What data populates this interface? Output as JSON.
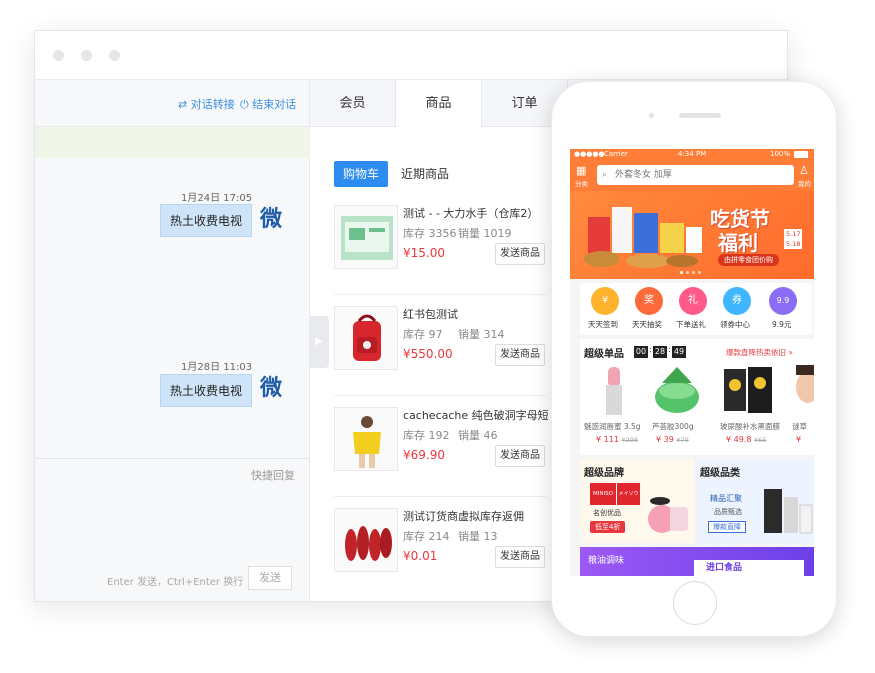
{
  "chat": {
    "transfer": "对话转接",
    "end": "结束对话",
    "messages": [
      {
        "time": "1月24日 17:05",
        "text": "热土收费电视"
      },
      {
        "time": "1月28日 11:03",
        "text": "热土收费电视"
      }
    ],
    "avatar_char": "微",
    "quick_reply": "快捷回复",
    "hint": "Enter 发送，Ctrl+Enter 换行",
    "send": "发送"
  },
  "tabs": [
    "会员",
    "商品",
    "订单"
  ],
  "active_tab": "商品",
  "subtabs": {
    "cart": "购物车",
    "recent": "近期商品"
  },
  "products": [
    {
      "name": "测试 - - 大力水手（仓库2）",
      "stock": "库存 3356",
      "sales": "销量 1019",
      "price": "¥15.00",
      "send": "发送商品"
    },
    {
      "name": "红书包测试",
      "stock": "库存 97",
      "sales": "销量 314",
      "price": "¥550.00",
      "send": "发送商品"
    },
    {
      "name": "cachecache 纯色破洞字母短袖...",
      "stock": "库存 192",
      "sales": "销量 46",
      "price": "¥69.90",
      "send": "发送商品"
    },
    {
      "name": "测试订货商虚拟库存返佣",
      "stock": "库存 214",
      "sales": "销量 13",
      "price": "¥0.01",
      "send": "发送商品"
    }
  ],
  "phone": {
    "status": {
      "carrier": "Carrier",
      "time": "4:34 PM",
      "battery": "100%"
    },
    "category": "分类",
    "search_placeholder": "外套冬女 加厚",
    "me": "我的",
    "banner": {
      "title1": "吃货节",
      "title2": "福利",
      "date1": "5.17",
      "date2": "5.18",
      "sub": "由拼零食团价购"
    },
    "icons": [
      {
        "label": "天天签到",
        "glyph": "¥",
        "color": "#ffb22b"
      },
      {
        "label": "天天抽奖",
        "glyph": "奖",
        "color": "#ff6a3d"
      },
      {
        "label": "下单送礼",
        "glyph": "礼",
        "color": "#ff5a8a"
      },
      {
        "label": "领券中心",
        "glyph": "券",
        "color": "#3fb6ff"
      },
      {
        "label": "9.9元",
        "glyph": "9.9",
        "color": "#8b6cf5"
      }
    ],
    "single": {
      "title": "超级单品",
      "countdown": [
        "00",
        "28",
        "49"
      ],
      "promo": "爆款直降热卖依旧 »",
      "items": [
        {
          "name": "魅惑润唇蜜 3.5g",
          "price": "¥ 111",
          "old": "¥298"
        },
        {
          "name": "芦荟胶300g",
          "price": "¥ 39",
          "old": "¥79"
        },
        {
          "name": "玻尿酸补水黑面膜",
          "price": "¥ 49.8",
          "old": "¥65"
        },
        {
          "name": "谜草",
          "price": "¥",
          "old": ""
        }
      ]
    },
    "brand": {
      "title": "超级品牌",
      "logo1": "MINISO",
      "logo2": "メイソウ",
      "tag": "名创优品",
      "badge": "低至4折"
    },
    "cat": {
      "title": "超级品类",
      "name": "精品汇聚",
      "sub": "品质甄选",
      "badge": "爆款直降"
    },
    "bottom": {
      "left": "粮油调味",
      "right": "进口食品"
    }
  }
}
